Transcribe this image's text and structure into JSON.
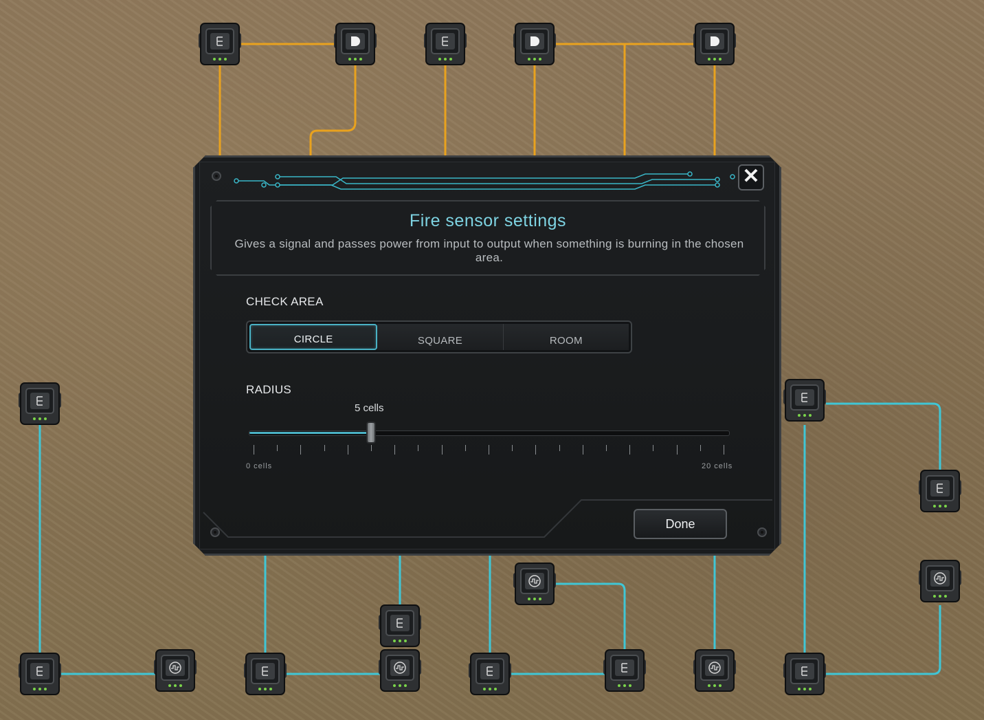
{
  "dialog": {
    "title": "Fire sensor settings",
    "description": "Gives a signal and passes power from input to output when something is burning in the chosen area.",
    "close_icon": "close-icon",
    "done_label": "Done"
  },
  "check_area": {
    "label": "CHECK AREA",
    "options": [
      "CIRCLE",
      "SQUARE",
      "ROOM"
    ],
    "selected": "CIRCLE"
  },
  "radius": {
    "label": "RADIUS",
    "value": 5,
    "value_text": "5 cells",
    "min": 0,
    "max": 20,
    "min_label": "0 cells",
    "max_label": "20 cells"
  },
  "colors": {
    "accent": "#4ab2c5",
    "power_wire": "#e9a21e",
    "signal_wire": "#3fc6d6"
  },
  "board": {
    "device_icons": [
      "logic-gate-icon",
      "and-gate-icon",
      "pulse-sensor-icon"
    ]
  }
}
